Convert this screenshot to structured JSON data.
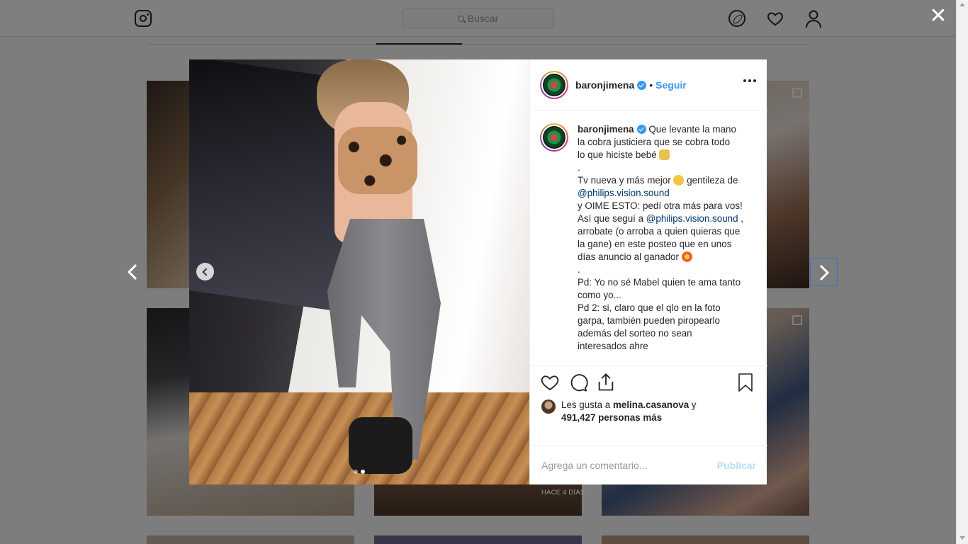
{
  "nav": {
    "search_placeholder": "Buscar"
  },
  "post": {
    "username": "baronjimena",
    "separator": "•",
    "follow_label": "Seguir",
    "caption_lines": [
      {
        "text": "Que levante la mano"
      },
      {
        "text": "la cobra justiciera que se cobra todo"
      },
      {
        "text": "lo que hiciste bebé"
      },
      {
        "text": "."
      },
      {
        "text": "Tv nueva y más mejor"
      },
      {
        "text": "gentileza de"
      },
      {
        "text": "@philips.vision.sound"
      },
      {
        "text": "y OIME ESTO: pedí otra más para vos!"
      },
      {
        "text": "Así que seguí a"
      },
      {
        "text": "@philips.vision.sound"
      },
      {
        "text": ","
      },
      {
        "text": "arrobate (o arroba a quien quieras que"
      },
      {
        "text": "la gane) en este posteo que en unos"
      },
      {
        "text": "días anuncio al ganador"
      },
      {
        "text": "."
      },
      {
        "text": "Pd: Yo no sé Mabel quien te ama tanto"
      },
      {
        "text": "como yo..."
      },
      {
        "text": "Pd 2: si, claro que el qlo en la foto"
      },
      {
        "text": "garpa, también pueden piropearlo"
      },
      {
        "text": "además del sorteo no sean"
      },
      {
        "text": "interesados ahre"
      }
    ],
    "likes_prefix": "Les gusta a",
    "likes_user": "melina.casanova",
    "likes_and": "y",
    "likes_count": "491,427 personas más",
    "timestamp": "HACE 4 DÍAS",
    "comment_placeholder": "Agrega un comentario...",
    "publish_label": "Publicar",
    "carousel": {
      "total": 2,
      "active": 2
    }
  },
  "overlay": {
    "close_glyph": "✕"
  },
  "colors": {
    "accent": "#3897f0",
    "mention": "#003569",
    "publish_disabled": "#b2dffc"
  }
}
